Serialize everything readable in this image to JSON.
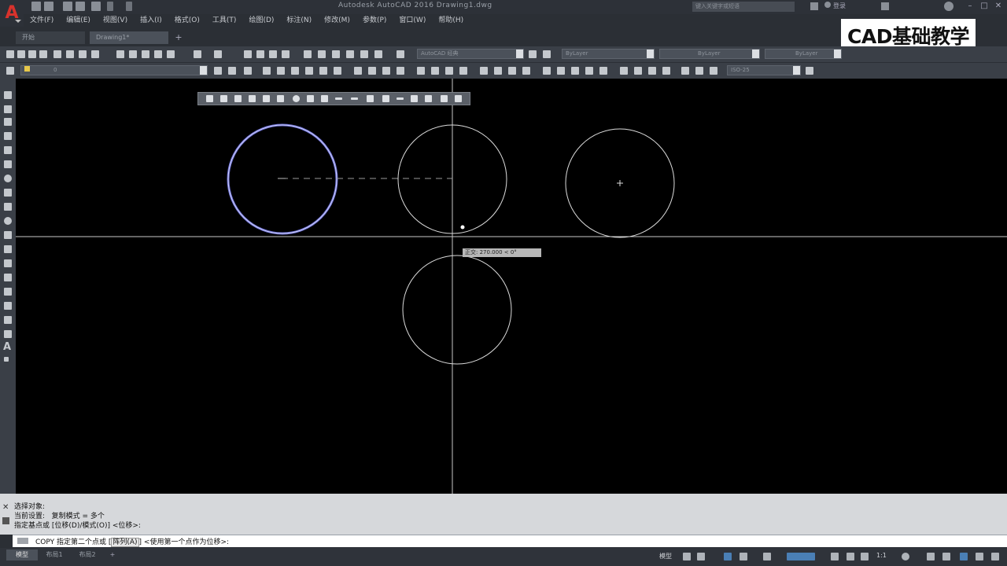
{
  "app": {
    "title": "Autodesk AutoCAD 2016    Drawing1.dwg",
    "search_placeholder": "键入关键字或短语",
    "login_label": "登录"
  },
  "menu": [
    "文件(F)",
    "编辑(E)",
    "视图(V)",
    "插入(I)",
    "格式(O)",
    "工具(T)",
    "绘图(D)",
    "标注(N)",
    "修改(M)",
    "参数(P)",
    "窗口(W)",
    "帮助(H)"
  ],
  "tabs": {
    "start": "开始",
    "drawing": "Drawing1*",
    "add": "+"
  },
  "toolbar": {
    "workspace": "AutoCAD 经典",
    "layer": "ByLayer",
    "linetype": "ByLayer",
    "lineweight": "ByLayer",
    "layer_state": "0",
    "dimstyle": "ISO-25"
  },
  "watermark": "CAD基础教学",
  "viewport": {
    "tooltip": "正交: 270.000 < 0°"
  },
  "command": {
    "history": [
      "选择对象:",
      "当前设置:   复制模式 = 多个",
      "指定基点或 [位移(D)/模式(O)] <位移>:"
    ],
    "prompt_prefix": "COPY 指定第二个点或 [",
    "prompt_option": "阵列(A)",
    "prompt_suffix": "] <使用第一个点作为位移>:"
  },
  "status": {
    "tab_model": "模型",
    "tab_layout1": "布局1",
    "tab_layout2": "布局2",
    "model_label": "模型",
    "scale": "1:1"
  },
  "colors": {
    "accent_red": "#d8322c",
    "selected_circle": "#6f72d8",
    "canvas": "#000000"
  }
}
